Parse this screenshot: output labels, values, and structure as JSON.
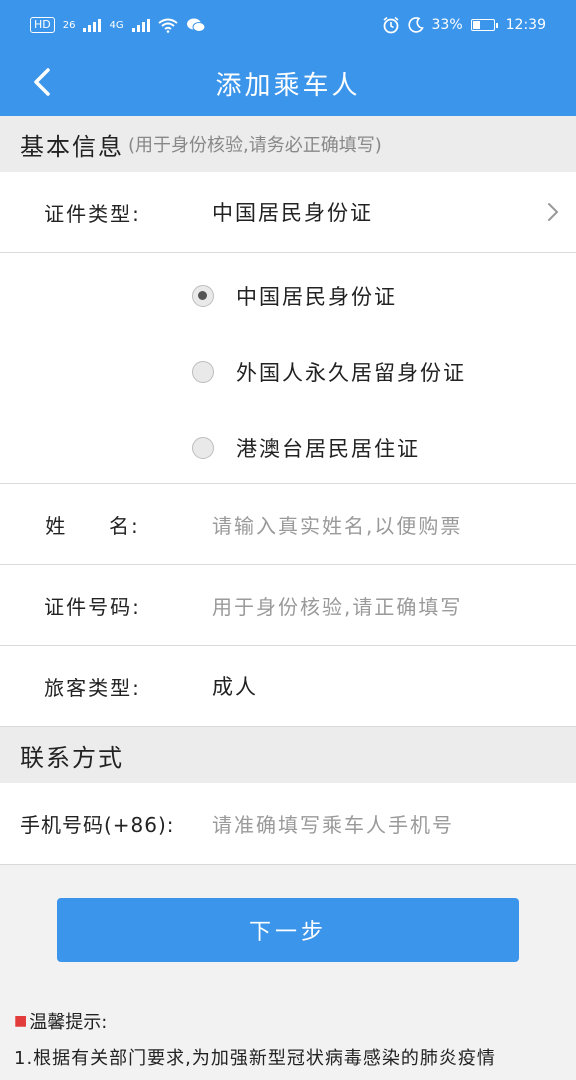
{
  "status_bar": {
    "hd": "HD",
    "net1": "26",
    "net2": "4G",
    "battery": "33%",
    "battery_level": 0.33,
    "time": "12:39"
  },
  "nav": {
    "title": "添加乘车人"
  },
  "basic_section": {
    "title": "基本信息",
    "hint": "(用于身份核验,请务必正确填写)"
  },
  "id_type": {
    "label": "证件类型:",
    "value": "中国居民身份证",
    "options": [
      {
        "label": "中国居民身份证",
        "checked": true
      },
      {
        "label": "外国人永久居留身份证",
        "checked": false
      },
      {
        "label": "港澳台居民居住证",
        "checked": false
      }
    ]
  },
  "name": {
    "label": "姓    名:",
    "placeholder": "请输入真实姓名,以便购票"
  },
  "id_number": {
    "label": "证件号码:",
    "placeholder": "用于身份核验,请正确填写"
  },
  "passenger_type": {
    "label": "旅客类型:",
    "value": "成人"
  },
  "contact_section": {
    "title": "联系方式"
  },
  "phone": {
    "label": "手机号码(+86):",
    "placeholder": "请准确填写乘车人手机号"
  },
  "next_button": {
    "label": "下一步"
  },
  "tips": {
    "title": "温馨提示:",
    "line1": "1.根据有关部门要求,为加强新型冠状病毒感染的肺炎疫情"
  }
}
